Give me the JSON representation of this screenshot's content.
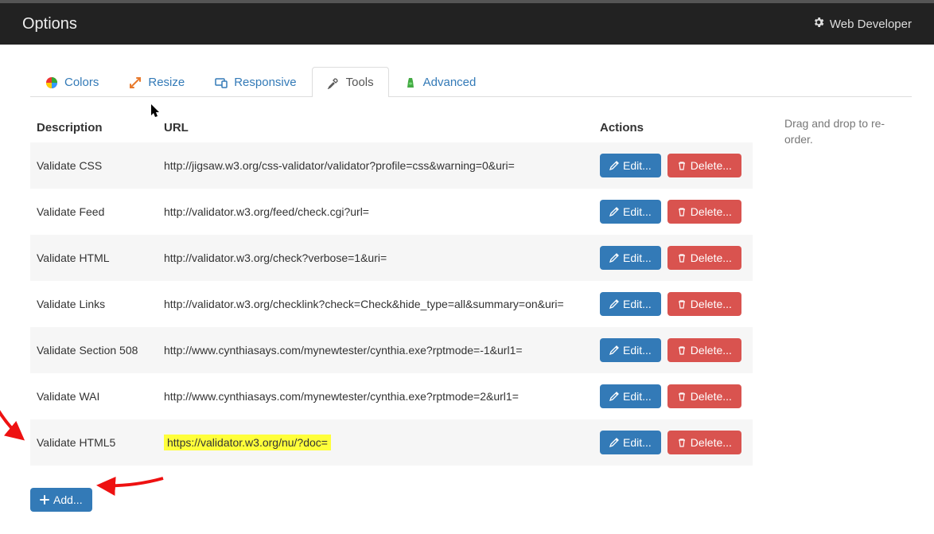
{
  "header": {
    "title": "Options",
    "brand": "Web Developer"
  },
  "tabs": [
    {
      "label": "Colors",
      "icon": "colors-icon"
    },
    {
      "label": "Resize",
      "icon": "resize-icon"
    },
    {
      "label": "Responsive",
      "icon": "responsive-icon"
    },
    {
      "label": "Tools",
      "icon": "tools-icon"
    },
    {
      "label": "Advanced",
      "icon": "advanced-icon"
    }
  ],
  "columns": {
    "description": "Description",
    "url": "URL",
    "actions": "Actions"
  },
  "rows": [
    {
      "desc": "Validate CSS",
      "url": "http://jigsaw.w3.org/css-validator/validator?profile=css&warning=0&uri="
    },
    {
      "desc": "Validate Feed",
      "url": "http://validator.w3.org/feed/check.cgi?url="
    },
    {
      "desc": "Validate HTML",
      "url": "http://validator.w3.org/check?verbose=1&uri="
    },
    {
      "desc": "Validate Links",
      "url": "http://validator.w3.org/checklink?check=Check&hide_type=all&summary=on&uri="
    },
    {
      "desc": "Validate Section 508",
      "url": "http://www.cynthiasays.com/mynewtester/cynthia.exe?rptmode=-1&url1="
    },
    {
      "desc": "Validate WAI",
      "url": "http://www.cynthiasays.com/mynewtester/cynthia.exe?rptmode=2&url1="
    },
    {
      "desc": "Validate HTML5",
      "url": "https://validator.w3.org/nu/?doc=",
      "highlight": true
    }
  ],
  "buttons": {
    "edit": "Edit...",
    "delete": "Delete...",
    "add": "Add..."
  },
  "side_note": "Drag and drop to re-order.",
  "colors": {
    "primary": "#337ab7",
    "danger": "#d9534f",
    "highlight": "#ffff3a"
  }
}
